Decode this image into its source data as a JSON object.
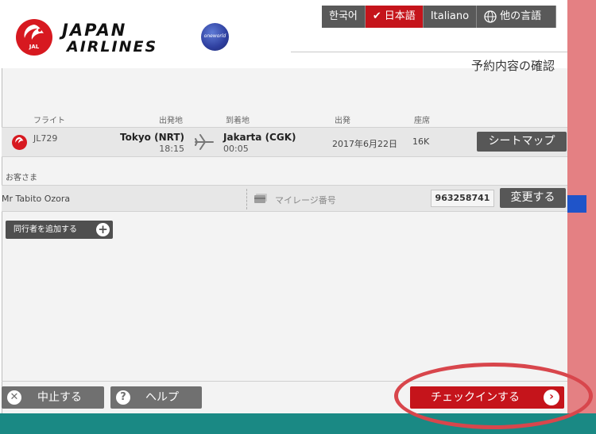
{
  "header": {
    "brand_line1": "JAPAN",
    "brand_line2": "AIRLINES",
    "logo_text": "JAL",
    "alliance_text": "oneworld",
    "page_title": "予約内容の確認"
  },
  "languages": [
    {
      "label": "한국어",
      "active": false
    },
    {
      "label": "日本語",
      "active": true
    },
    {
      "label": "Italiano",
      "active": false
    },
    {
      "label": "他の言語",
      "active": false
    }
  ],
  "columns": {
    "flight": "フライト",
    "origin": "出発地",
    "destination": "到着地",
    "departure": "出発",
    "seat": "座席"
  },
  "flight": {
    "number": "JL729",
    "origin_city": "Tokyo (NRT)",
    "origin_time": "18:15",
    "destination_city": "Jakarta (CGK)",
    "destination_time": "00:05",
    "date": "2017年6月22日",
    "seat": "16K",
    "seatmap_label": "シートマップ"
  },
  "passenger": {
    "section_label": "お客さま",
    "name": "Mr Tabito Ozora",
    "mileage_placeholder": "マイレージ番号",
    "mileage_number": "963258741",
    "change_label": "変更する",
    "add_companion_label": "同行者を追加する"
  },
  "footer": {
    "cancel_label": "中止する",
    "help_label": "ヘルプ",
    "checkin_label": "チェックインする"
  },
  "colors": {
    "brand_red": "#c5141b",
    "button_gray": "#575757",
    "highlight": "#d8464c"
  }
}
